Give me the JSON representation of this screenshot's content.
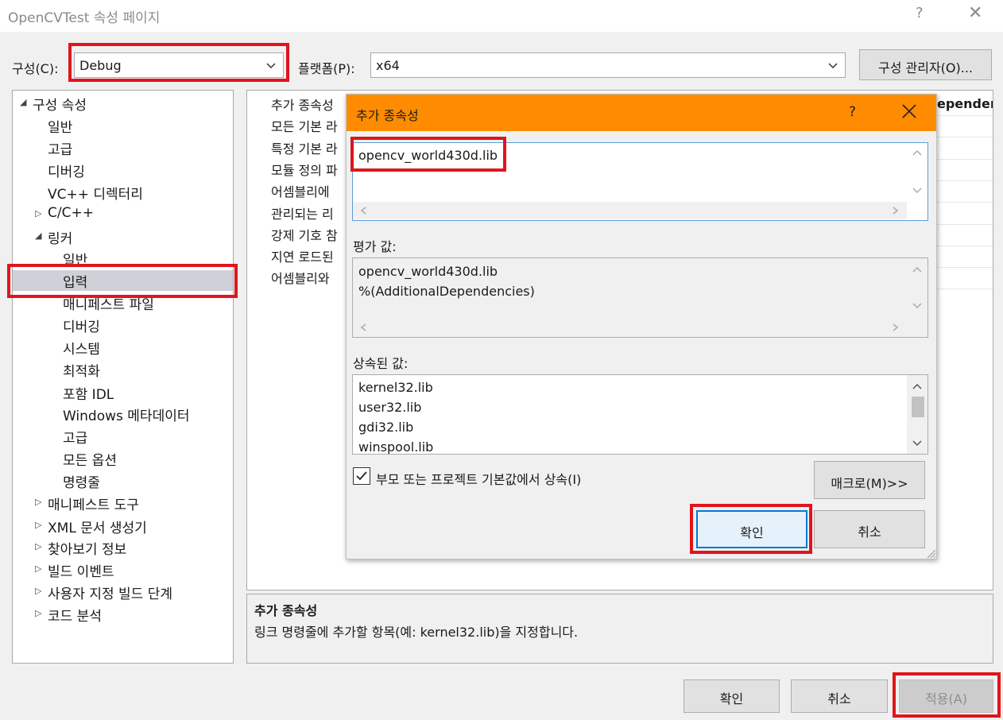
{
  "window": {
    "title": "OpenCVTest 속성 페이지",
    "help_glyph": "?",
    "close_glyph": "✕"
  },
  "toolbar": {
    "config_label": "구성(C):",
    "config_value": "Debug",
    "platform_label": "플랫폼(P):",
    "platform_value": "x64",
    "config_manager_label": "구성 관리자(O)..."
  },
  "tree": {
    "items": [
      {
        "label": "구성 속성",
        "state": "expanded"
      },
      {
        "label": "일반"
      },
      {
        "label": "고급"
      },
      {
        "label": "디버깅"
      },
      {
        "label": "VC++ 디렉터리"
      },
      {
        "label": "C/C++",
        "state": "collapsed"
      },
      {
        "label": "링커",
        "state": "expanded"
      },
      {
        "label": "일반"
      },
      {
        "label": "입력",
        "selected": true
      },
      {
        "label": "매니페스트 파일"
      },
      {
        "label": "디버깅"
      },
      {
        "label": "시스템"
      },
      {
        "label": "최적화"
      },
      {
        "label": "포함 IDL"
      },
      {
        "label": "Windows 메타데이터"
      },
      {
        "label": "고급"
      },
      {
        "label": "모든 옵션"
      },
      {
        "label": "명령줄"
      },
      {
        "label": "매니페스트 도구",
        "state": "collapsed"
      },
      {
        "label": "XML 문서 생성기",
        "state": "collapsed"
      },
      {
        "label": "찾아보기 정보",
        "state": "collapsed"
      },
      {
        "label": "빌드 이벤트",
        "state": "collapsed"
      },
      {
        "label": "사용자 지정 빌드 단계",
        "state": "collapsed"
      },
      {
        "label": "코드 분석",
        "state": "collapsed"
      }
    ]
  },
  "grid": {
    "rows": [
      "추가 종속성",
      "모든 기본 라",
      "특정 기본 라",
      "모듈 정의 파",
      "어셈블리에",
      "관리되는 리",
      "강제 기호 참",
      "지연 로드된",
      "어셈블리와"
    ],
    "value_fragment": "ependenc"
  },
  "description": {
    "title": "추가 종속성",
    "text": "링크 명령줄에 추가할 항목(예: kernel32.lib)을 지정합니다."
  },
  "dialog": {
    "title": "추가 종속성",
    "help_glyph": "?",
    "edit_value": "opencv_world430d.lib",
    "evaluated_label": "평가 값:",
    "evaluated_lines": [
      "opencv_world430d.lib",
      "%(AdditionalDependencies)"
    ],
    "inherited_label": "상속된 값:",
    "inherited_lines": [
      "kernel32.lib",
      "user32.lib",
      "gdi32.lib",
      "winspool.lib"
    ],
    "inherit_checkbox_label": "부모 또는 프로젝트 기본값에서 상속(I)",
    "inherit_checked": true,
    "macro_button": "매크로(M)>>",
    "ok_button": "확인",
    "cancel_button": "취소"
  },
  "footer": {
    "ok_button": "확인",
    "cancel_button": "취소",
    "apply_button": "적용(A)"
  },
  "colors": {
    "dialog_title_bg": "#ff8c00",
    "highlight_border": "#e0151c",
    "tree_selection": "#cfd0d8",
    "focus_border": "#0078d7"
  }
}
